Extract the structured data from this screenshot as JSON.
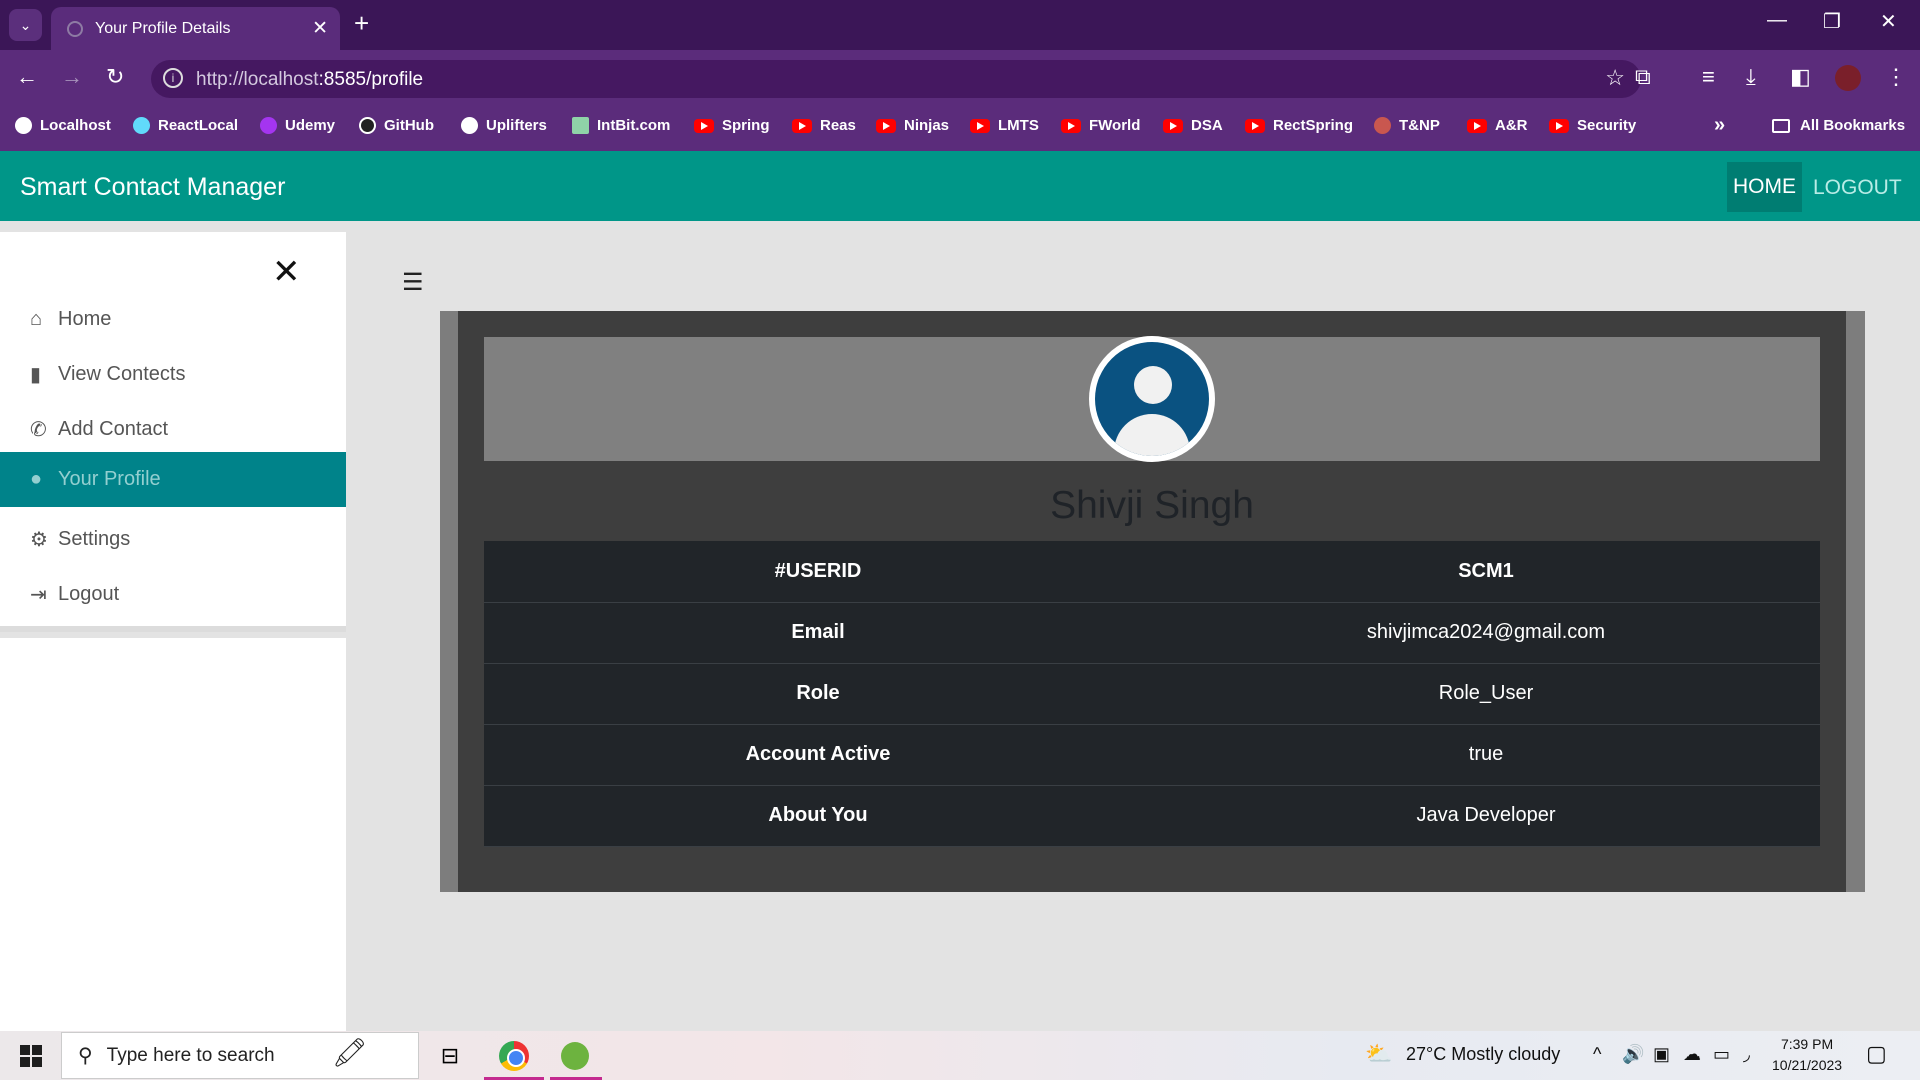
{
  "browser": {
    "tab_title": "Your Profile Details",
    "url_host": "http://localhost",
    "url_rest": ":8585/profile",
    "bookmarks": [
      "Localhost",
      "ReactLocal",
      "Udemy",
      "GitHub",
      "Uplifters",
      "IntBit.com",
      "Spring",
      "Reas",
      "Ninjas",
      "LMTS",
      "FWorld",
      "DSA",
      "RectSpring",
      "T&NP",
      "A&R",
      "Security"
    ],
    "all_bookmarks": "All Bookmarks"
  },
  "app": {
    "brand": "Smart Contact Manager",
    "nav_home": "HOME",
    "nav_logout": "LOGOUT"
  },
  "sidebar": {
    "items": [
      {
        "label": "Home",
        "icon": "home-icon"
      },
      {
        "label": "View Contects",
        "icon": "file-icon"
      },
      {
        "label": "Add Contact",
        "icon": "phone-icon"
      },
      {
        "label": "Your Profile",
        "icon": "user-icon",
        "active": true
      },
      {
        "label": "Settings",
        "icon": "gear-icon"
      },
      {
        "label": "Logout",
        "icon": "logout-icon"
      }
    ]
  },
  "profile": {
    "name": "Shivji Singh",
    "rows": [
      {
        "key": "#USERID",
        "value": "SCM1"
      },
      {
        "key": "Email",
        "value": "shivjimca2024@gmail.com"
      },
      {
        "key": "Role",
        "value": "Role_User"
      },
      {
        "key": "Account Active",
        "value": "true"
      },
      {
        "key": "About You",
        "value": "Java Developer"
      }
    ]
  },
  "taskbar": {
    "search_placeholder": "Type here to search",
    "weather": "27°C  Mostly cloudy",
    "time": "7:39 PM",
    "date": "10/21/2023"
  },
  "colors": {
    "navbar": "#009688",
    "active_item": "#00838a",
    "browser_frame": "#5b2c7b"
  }
}
